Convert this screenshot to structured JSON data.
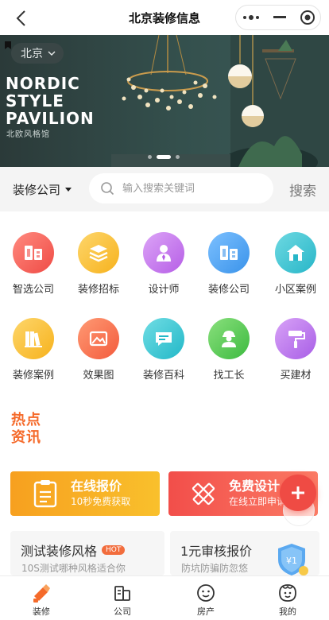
{
  "header": {
    "title": "北京装修信息"
  },
  "banner": {
    "city": "北京",
    "title_lines": [
      "NORDIC",
      "STYLE",
      "PAVILION"
    ],
    "subtitle": "北欧风格馆"
  },
  "search": {
    "category": "装修公司",
    "placeholder": "输入搜索关键词",
    "button_label": "搜索"
  },
  "menu": [
    {
      "label": "智选公司",
      "icon": "building-icon",
      "color": "#ef4b45",
      "color2": "#ff8a7f"
    },
    {
      "label": "装修招标",
      "icon": "stack-icon",
      "color": "#f7b21d",
      "color2": "#fdd66b"
    },
    {
      "label": "设计师",
      "icon": "designer-icon",
      "color": "#b65ee6",
      "color2": "#dca4f7"
    },
    {
      "label": "装修公司",
      "icon": "building-icon",
      "color": "#3a93ea",
      "color2": "#7cc0ff"
    },
    {
      "label": "小区案例",
      "icon": "home-icon",
      "color": "#27b6c8",
      "color2": "#6ed9e2"
    },
    {
      "label": "装修案例",
      "icon": "books-icon",
      "color": "#f7b21d",
      "color2": "#fdd66b"
    },
    {
      "label": "效果图",
      "icon": "picture-icon",
      "color": "#f35b3c",
      "color2": "#ff9a74"
    },
    {
      "label": "装修百科",
      "icon": "chat-icon",
      "color": "#22b8c8",
      "color2": "#70dde4"
    },
    {
      "label": "找工长",
      "icon": "worker-icon",
      "color": "#3cba3f",
      "color2": "#8ae07d"
    },
    {
      "label": "买建材",
      "icon": "paint-roller-icon",
      "color": "#a85ee6",
      "color2": "#d8a2f7"
    }
  ],
  "hot_news": {
    "line1": "热点",
    "line2": "资讯"
  },
  "promos": [
    {
      "title": "在线报价",
      "subtitle": "10秒免费获取",
      "icon": "clipboard-icon"
    },
    {
      "title": "免费设计",
      "subtitle": "在线立即申请",
      "icon": "ruler-pencil-icon"
    }
  ],
  "info_cards": [
    {
      "title": "测试装修风格",
      "badge": "HOT",
      "subtitle": "10S测试哪种风格适合你"
    },
    {
      "title": "1元审核报价",
      "subtitle": "防坑防骗防忽悠",
      "shield_text": "¥1"
    }
  ],
  "tabs": [
    {
      "label": "装修",
      "icon": "hammer-icon",
      "active": true
    },
    {
      "label": "公司",
      "icon": "company-icon"
    },
    {
      "label": "房产",
      "icon": "face-icon"
    },
    {
      "label": "我的",
      "icon": "profile-icon"
    }
  ],
  "colors": {
    "accent": "#f56a2a",
    "fab": "#ef4b44"
  }
}
